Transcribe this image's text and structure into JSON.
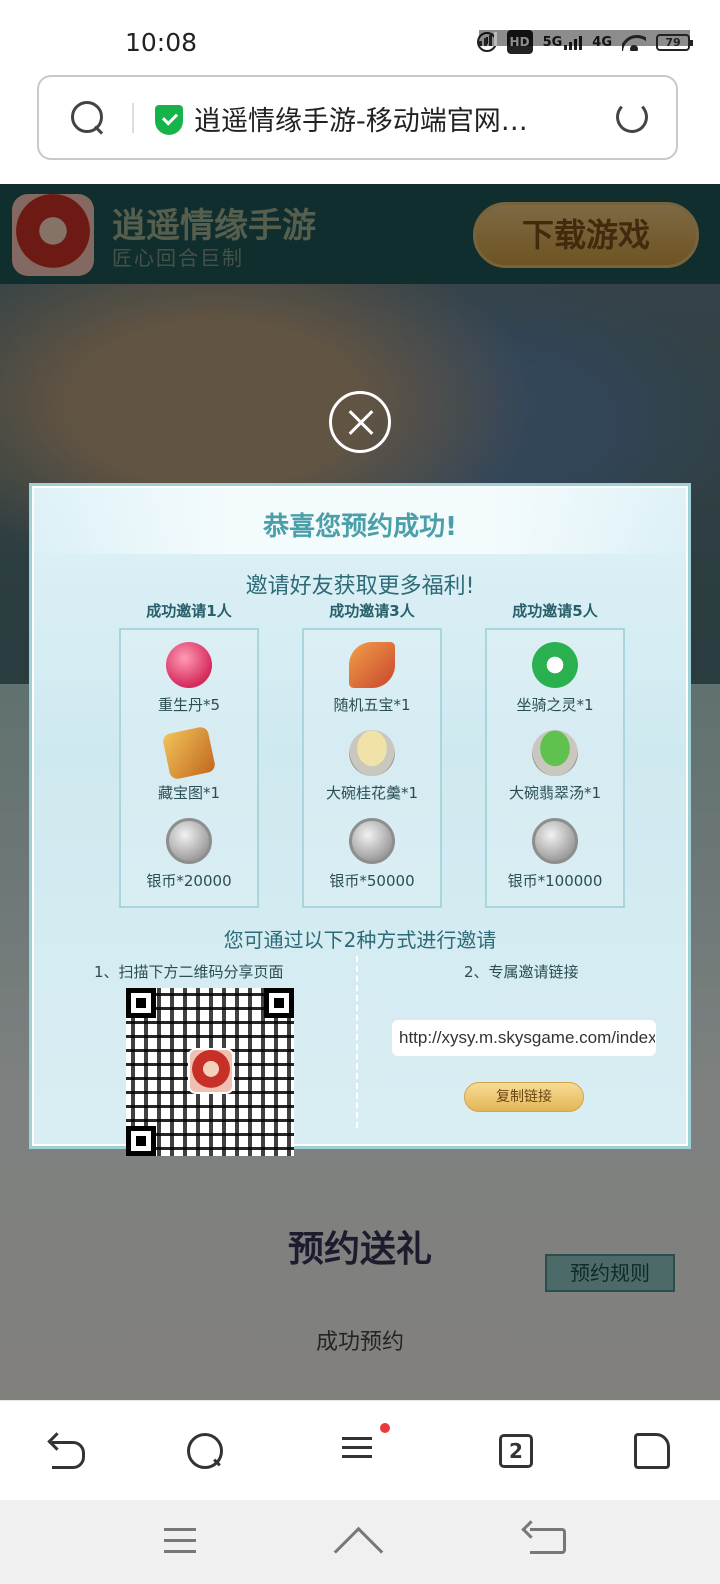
{
  "status_bar": {
    "time": "10:08",
    "hd": "HD",
    "net1": "5G",
    "net2": "4G",
    "battery": "79"
  },
  "url_bar": {
    "title": "逍遥情缘手游-移动端官网…"
  },
  "top_banner": {
    "app_name": "逍遥情缘手游",
    "tagline": "匠心回合巨制",
    "download_label": "下载游戏"
  },
  "page": {
    "gift_title": "预约送礼",
    "rules_label": "预约规则",
    "success_label": "成功预约"
  },
  "modal": {
    "title": "恭喜您预约成功!",
    "subtitle": "邀请好友获取更多福利!",
    "tiers": [
      {
        "header": "成功邀请1人",
        "rewards": [
          "重生丹*5",
          "藏宝图*1",
          "银币*20000"
        ]
      },
      {
        "header": "成功邀请3人",
        "rewards": [
          "随机五宝*1",
          "大碗桂花羹*1",
          "银币*50000"
        ]
      },
      {
        "header": "成功邀请5人",
        "rewards": [
          "坐骑之灵*1",
          "大碗翡翠汤*1",
          "银币*100000"
        ]
      }
    ],
    "methods_title": "您可通过以下2种方式进行邀请",
    "method1": "1、扫描下方二维码分享页面",
    "method2": "2、专属邀请链接",
    "invite_link": "http://xysy.m.skysgame.com/index",
    "copy_label": "复制链接"
  },
  "browser_bar": {
    "tab_count": "2"
  }
}
